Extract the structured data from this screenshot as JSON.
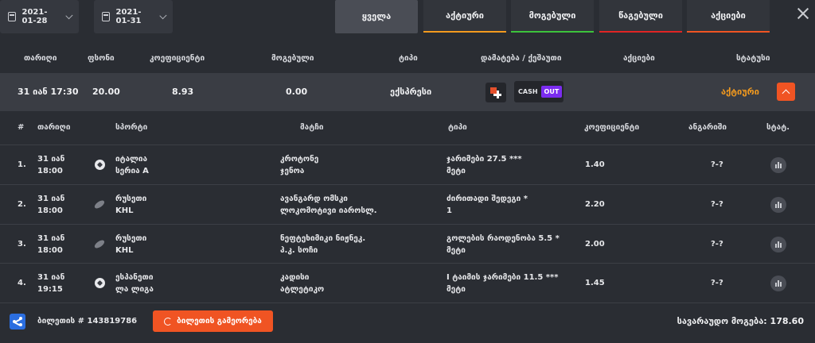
{
  "filters": {
    "date_from": "2021-01-28",
    "date_to": "2021-01-31",
    "tabs": [
      {
        "label": "ყველა",
        "accent": ""
      },
      {
        "label": "აქტიური",
        "accent": "#f39a1e"
      },
      {
        "label": "მოგებული",
        "accent": "#3cc33c"
      },
      {
        "label": "წაგებული",
        "accent": "#e02424"
      },
      {
        "label": "აქციები",
        "accent": "#f05423"
      }
    ]
  },
  "bets_table": {
    "headers": [
      "თარიღი",
      "ფსონი",
      "კოეფიციენტი",
      "მოგებული",
      "ტიპი",
      "დამატება / ქეშაუთი",
      "აქციები",
      "სტატუსი"
    ],
    "bet": {
      "date": "31 იან 17:30",
      "stake": "20.00",
      "odds": "8.93",
      "won": "0.00",
      "type": "ექსპრესი",
      "cashout_cash": "CASH",
      "cashout_out": "OUT",
      "status": "აქტიური"
    }
  },
  "selections": {
    "headers": [
      "#",
      "თარიღი",
      "სპორტი",
      "მატჩი",
      "ტიპი",
      "კოეფიციენტი",
      "ანგარიში",
      "სტატ."
    ],
    "rows": [
      {
        "num": "1.",
        "date": "31 იან",
        "time": "18:00",
        "sport_icon": "soccer-ball-icon",
        "country": "იტალია",
        "league": "სერია A",
        "team1": "კროტონე",
        "team2": "ჯენოა",
        "market": "ჯარიმები 27.5 ***",
        "pick": "მეტი",
        "odds": "1.40",
        "score": "?-?"
      },
      {
        "num": "2.",
        "date": "31 იან",
        "time": "18:00",
        "sport_icon": "hockey-puck-icon",
        "country": "რუსეთი",
        "league": "KHL",
        "team1": "ავანგარდ ომსკი",
        "team2": "ლოკომოტივი იაროსლ.",
        "market": "ძირითადი შედეგი *",
        "pick": "1",
        "odds": "2.20",
        "score": "?-?"
      },
      {
        "num": "3.",
        "date": "31 იან",
        "time": "18:00",
        "sport_icon": "hockey-puck-icon",
        "country": "რუსეთი",
        "league": "KHL",
        "team1": "ნეფტეხიმიკი ნიჟნეკ.",
        "team2": "ჰ.კ. სოჩი",
        "market": "გოლების რაოდენობა 5.5 *",
        "pick": "მეტი",
        "odds": "2.00",
        "score": "?-?"
      },
      {
        "num": "4.",
        "date": "31 იან",
        "time": "19:15",
        "sport_icon": "soccer-ball-icon",
        "country": "ესპანეთი",
        "league": "ლა ლიგა",
        "team1": "კადისი",
        "team2": "ატლეტიკო",
        "market": "I ტაიმის ჯარიმები 11.5 ***",
        "pick": "მეტი",
        "odds": "1.45",
        "score": "?-?"
      }
    ]
  },
  "footer": {
    "ticket_id": "ბილეთის # 143819786",
    "repeat_label": "ბილეთის გამეორება",
    "possible_win": "სავარაუდო მოგება: 178.60"
  }
}
